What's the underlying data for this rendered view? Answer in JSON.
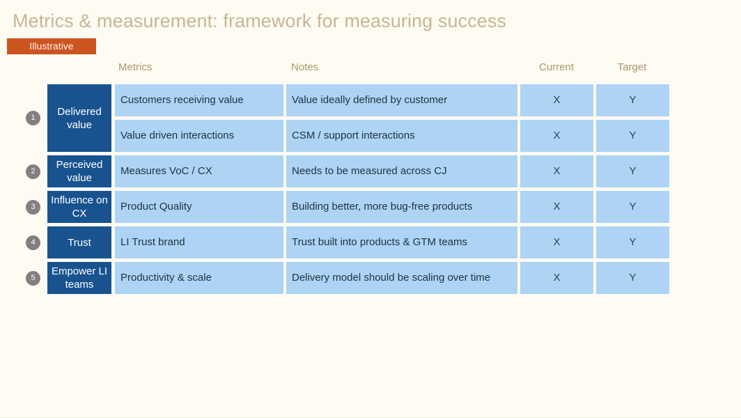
{
  "slide": {
    "title": "Metrics & measurement: framework for measuring success",
    "badge_label": "Illustrative",
    "colors": {
      "background": "#FDFBF2",
      "title_text": "#C8B694",
      "badge_background": "#CC551F",
      "badge_text": "#FBF6EE",
      "header_text": "#B0976B",
      "category_block": "#18538F",
      "category_text": "#FFFFFF",
      "cell_background": "#ADD4F4",
      "cell_text": "#1F3143",
      "number_badge": "#808080"
    }
  },
  "table": {
    "headers": {
      "metrics": "Metrics",
      "notes": "Notes",
      "current": "Current",
      "target": "Target"
    },
    "categories": [
      {
        "number": "1",
        "label": "Delivered value",
        "rows": 2
      },
      {
        "number": "2",
        "label": "Perceived value",
        "rows": 1
      },
      {
        "number": "3",
        "label": "Influence on CX",
        "rows": 1
      },
      {
        "number": "4",
        "label": "Trust",
        "rows": 1
      },
      {
        "number": "5",
        "label": "Empower LI teams",
        "rows": 1
      }
    ],
    "rows": [
      {
        "metric": "Customers receiving value",
        "note": "Value ideally defined by customer",
        "current": "X",
        "target": "Y"
      },
      {
        "metric": "Value driven interactions",
        "note": "CSM / support interactions",
        "current": "X",
        "target": "Y"
      },
      {
        "metric": "Measures VoC / CX",
        "note": "Needs to be measured across CJ",
        "current": "X",
        "target": "Y"
      },
      {
        "metric": "Product Quality",
        "note": "Building better, more bug-free products",
        "current": "X",
        "target": "Y"
      },
      {
        "metric": "LI Trust brand",
        "note": "Trust built into products & GTM teams",
        "current": "X",
        "target": "Y"
      },
      {
        "metric": "Productivity & scale",
        "note": "Delivery model should be scaling over time",
        "current": "X",
        "target": "Y"
      }
    ]
  }
}
